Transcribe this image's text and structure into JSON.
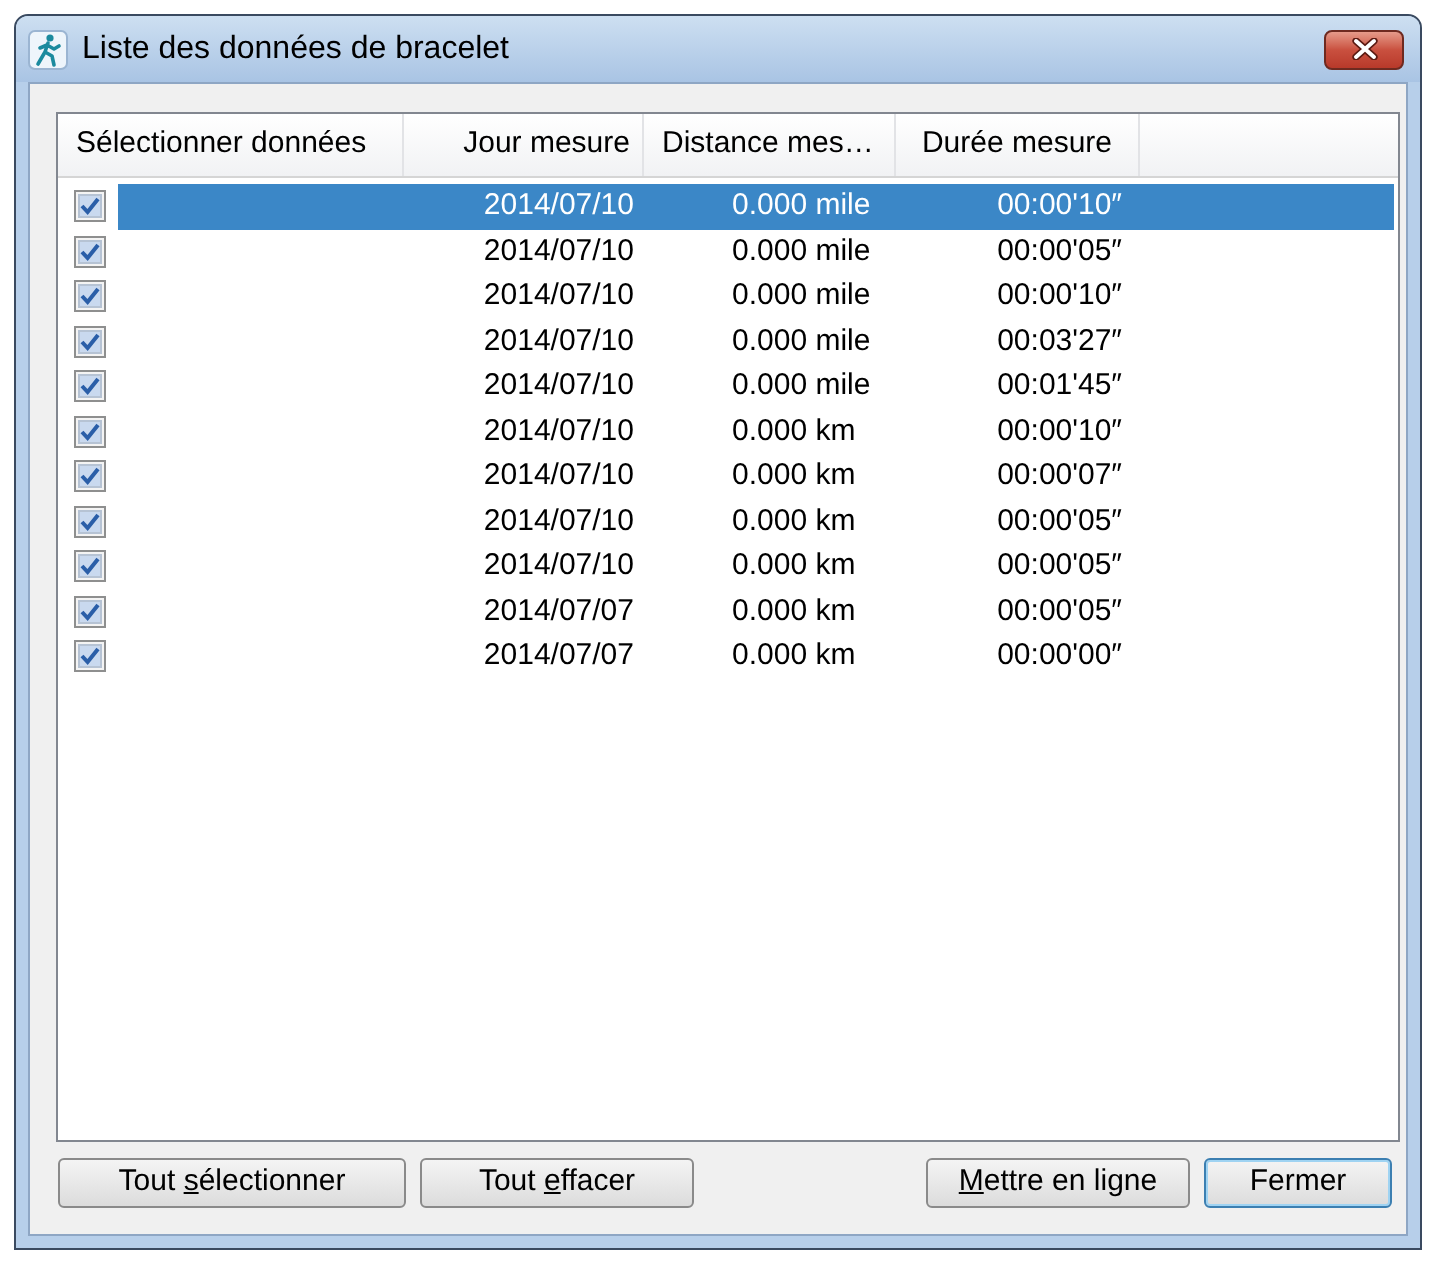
{
  "window": {
    "title": "Liste des données de bracelet"
  },
  "list": {
    "columns": [
      "Sélectionner données",
      "Jour mesure",
      "Distance mes…",
      "Durée mesure"
    ],
    "rows": [
      {
        "checked": true,
        "selected": true,
        "date": "2014/07/10",
        "distance": "0.000 mile",
        "duration": "00:00'10″"
      },
      {
        "checked": true,
        "selected": false,
        "date": "2014/07/10",
        "distance": "0.000 mile",
        "duration": "00:00'05″"
      },
      {
        "checked": true,
        "selected": false,
        "date": "2014/07/10",
        "distance": "0.000 mile",
        "duration": "00:00'10″"
      },
      {
        "checked": true,
        "selected": false,
        "date": "2014/07/10",
        "distance": "0.000 mile",
        "duration": "00:03'27″"
      },
      {
        "checked": true,
        "selected": false,
        "date": "2014/07/10",
        "distance": "0.000 mile",
        "duration": "00:01'45″"
      },
      {
        "checked": true,
        "selected": false,
        "date": "2014/07/10",
        "distance": "0.000 km",
        "duration": "00:00'10″"
      },
      {
        "checked": true,
        "selected": false,
        "date": "2014/07/10",
        "distance": "0.000 km",
        "duration": "00:00'07″"
      },
      {
        "checked": true,
        "selected": false,
        "date": "2014/07/10",
        "distance": "0.000 km",
        "duration": "00:00'05″"
      },
      {
        "checked": true,
        "selected": false,
        "date": "2014/07/10",
        "distance": "0.000 km",
        "duration": "00:00'05″"
      },
      {
        "checked": true,
        "selected": false,
        "date": "2014/07/07",
        "distance": "0.000 km",
        "duration": "00:00'05″"
      },
      {
        "checked": true,
        "selected": false,
        "date": "2014/07/07",
        "distance": "0.000 km",
        "duration": "00:00'00″"
      }
    ]
  },
  "buttons": [
    {
      "label": [
        {
          "text": "Tout ",
          "underlined": false
        },
        {
          "text": "s",
          "underlined": true
        },
        {
          "text": "électionner",
          "underlined": false
        }
      ],
      "default": false
    },
    {
      "label": [
        {
          "text": "Tout ",
          "underlined": false
        },
        {
          "text": "e",
          "underlined": true
        },
        {
          "text": "ffacer",
          "underlined": false
        }
      ],
      "default": false
    },
    {
      "label": [
        {
          "text": "M",
          "underlined": true
        },
        {
          "text": "ettre en ligne",
          "underlined": false
        }
      ],
      "default": false
    },
    {
      "label": [
        {
          "text": "Fermer",
          "underlined": false
        }
      ],
      "default": true
    }
  ]
}
